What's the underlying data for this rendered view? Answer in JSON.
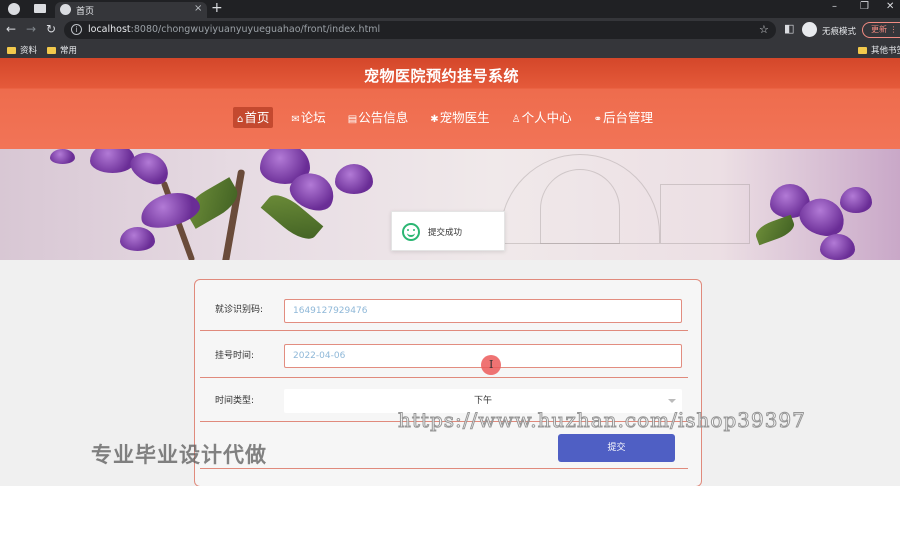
{
  "browser": {
    "tab_title": "首页",
    "tab_close": "×",
    "new_tab": "+",
    "url_host": "localhost",
    "url_path": ":8080/chongwuyiyuanyuyueguahao/front/index.html",
    "incognito_label": "无痕模式",
    "update_label": "更新",
    "bookmarks": [
      "资料",
      "常用",
      "其他书签"
    ],
    "window_controls": [
      "–",
      "❐",
      "✕"
    ]
  },
  "site": {
    "title": "宠物医院预约挂号系统",
    "nav": [
      {
        "icon": "⌂",
        "label": "首页",
        "active": true
      },
      {
        "icon": "✉",
        "label": "论坛"
      },
      {
        "icon": "▤",
        "label": "公告信息"
      },
      {
        "icon": "✱",
        "label": "宠物医生"
      },
      {
        "icon": "♙",
        "label": "个人中心"
      },
      {
        "icon": "⚭",
        "label": "后台管理"
      }
    ]
  },
  "toast": {
    "text": "提交成功"
  },
  "form": {
    "fields": [
      {
        "label": "就诊识别码:",
        "value": "1649127929476"
      },
      {
        "label": "挂号时间:",
        "value": "2022-04-06"
      },
      {
        "label": "时间类型:",
        "value": "下午"
      }
    ],
    "submit_label": "提交"
  },
  "watermarks": {
    "cn": "专业毕业设计代做",
    "url": "https://www.huzhan.com/ishop39397"
  },
  "colors": {
    "header": "#ee6c4d",
    "submit": "#4f5fc4",
    "border": "#e08a7c"
  }
}
